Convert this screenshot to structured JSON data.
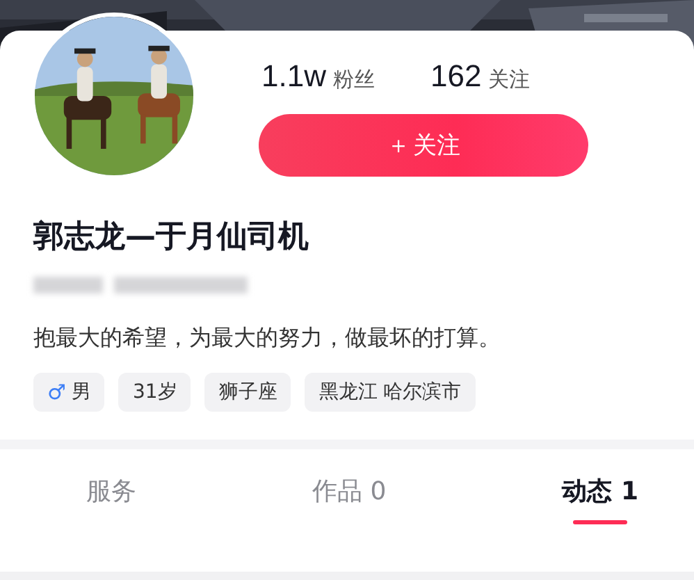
{
  "stats": [
    {
      "value": "1.1w",
      "label": "粉丝"
    },
    {
      "value": "162",
      "label": "关注"
    }
  ],
  "follow_button": {
    "icon": "＋",
    "label": "关注"
  },
  "name": "郭志龙—于月仙司机",
  "bio": "抱最大的希望，为最大的努力，做最坏的打算。",
  "tags": [
    {
      "kind": "gender",
      "icon": "♂",
      "label": "男"
    },
    {
      "kind": "plain",
      "label": "31岁"
    },
    {
      "kind": "plain",
      "label": "狮子座"
    },
    {
      "kind": "plain",
      "label": "黑龙江 哈尔滨市"
    }
  ],
  "tabs": [
    {
      "label": "服务",
      "selected": false
    },
    {
      "label": "作品 0",
      "selected": false
    },
    {
      "label": "动态 1",
      "selected": true
    }
  ]
}
